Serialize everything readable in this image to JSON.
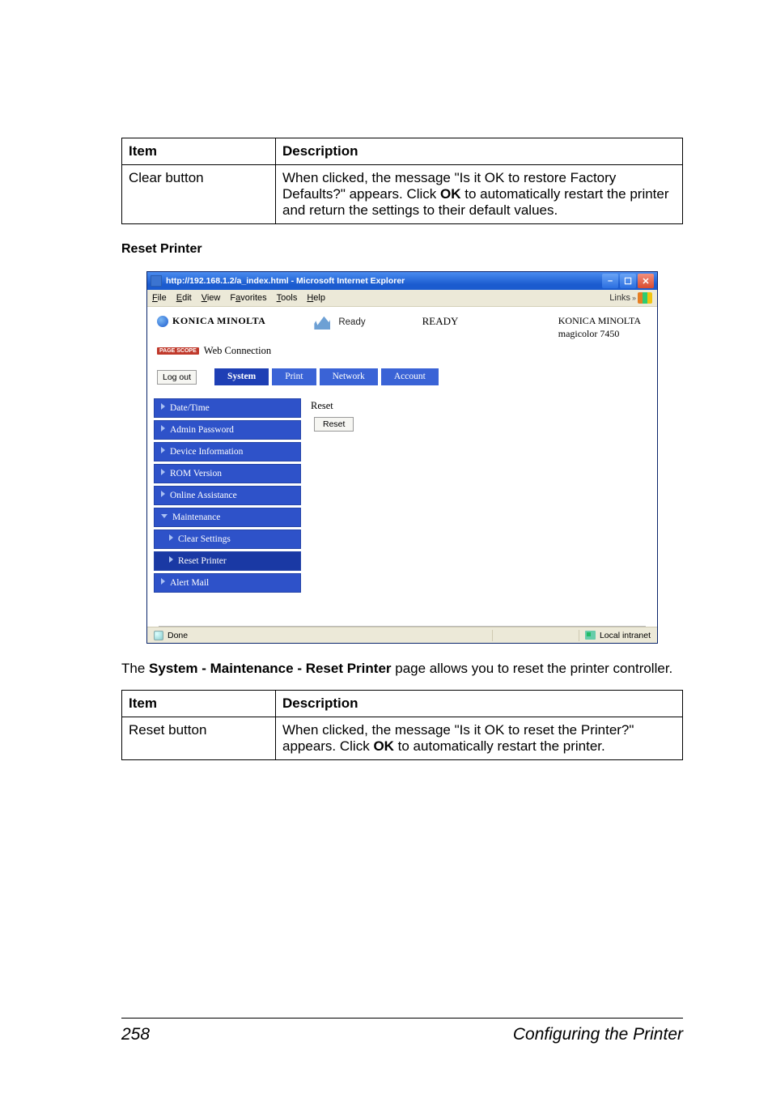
{
  "table1": {
    "header_item": "Item",
    "header_desc": "Description",
    "row1_item": "Clear button",
    "row1_desc_pre": "When clicked, the message \"Is it OK to restore Factory Defaults?\" appears. Click ",
    "row1_desc_bold": "OK",
    "row1_desc_post": " to automatically restart the printer and return the settings to their default values."
  },
  "section_heading": "Reset Printer",
  "ie": {
    "title": "http://192.168.1.2/a_index.html - Microsoft Internet Explorer",
    "menu": {
      "file": "File",
      "edit": "Edit",
      "view": "View",
      "favorites": "Favorites",
      "tools": "Tools",
      "help": "Help"
    },
    "links_label": "Links",
    "brand": "KONICA MINOLTA",
    "pagescope_label": "PAGE SCOPE",
    "webconnect": "Web Connection",
    "status_ready_small": "Ready",
    "status_ready_big": "READY",
    "model_line1": "KONICA MINOLTA",
    "model_line2": "magicolor 7450",
    "logout": "Log out",
    "tabs": {
      "system": "System",
      "print": "Print",
      "network": "Network",
      "account": "Account"
    },
    "sidebar": {
      "datetime": "Date/Time",
      "adminpw": "Admin Password",
      "devinfo": "Device Information",
      "romver": "ROM Version",
      "online": "Online Assistance",
      "maint": "Maintenance",
      "clear": "Clear Settings",
      "resetprinter": "Reset Printer",
      "alertmail": "Alert Mail"
    },
    "pane_title": "Reset",
    "reset_btn": "Reset",
    "status_done": "Done",
    "status_intranet": "Local intranet"
  },
  "body_para_pre": "The ",
  "body_para_bold": "System - Maintenance - Reset Printer",
  "body_para_post": " page allows you to reset the printer controller.",
  "table2": {
    "header_item": "Item",
    "header_desc": "Description",
    "row1_item": "Reset button",
    "row1_desc_pre": "When clicked, the message \"Is it OK to reset the Printer?\" appears. Click ",
    "row1_desc_bold": "OK",
    "row1_desc_post": " to automatically restart the printer."
  },
  "footer": {
    "page": "258",
    "title": "Configuring the Printer"
  }
}
